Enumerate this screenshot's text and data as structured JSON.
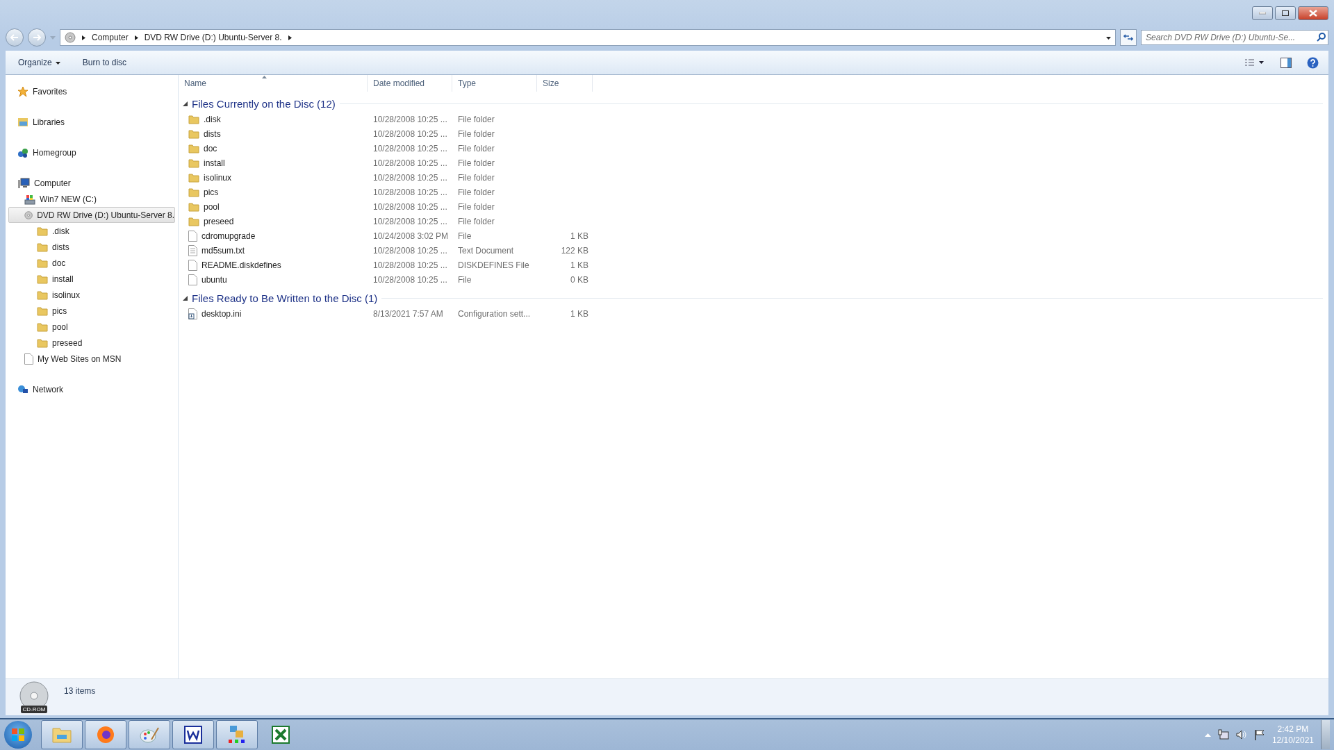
{
  "address": {
    "crumbs": [
      "Computer",
      "DVD RW Drive (D:) Ubuntu-Server 8."
    ]
  },
  "search": {
    "placeholder": "Search DVD RW Drive (D:) Ubuntu-Se..."
  },
  "toolbar": [
    {
      "label": "Organize",
      "dropdown": true
    },
    {
      "label": "Burn to disc",
      "dropdown": false
    }
  ],
  "sidebar": {
    "items": [
      {
        "label": "Favorites",
        "kind": "star",
        "selected": false
      },
      {
        "label": "Libraries",
        "kind": "library",
        "selected": false
      },
      {
        "label": "Homegroup",
        "kind": "homegroup",
        "selected": false
      },
      {
        "label": "Computer",
        "kind": "computer",
        "selected": false,
        "children": [
          {
            "label": "Win7 NEW (C:)",
            "kind": "drive",
            "selected": false
          },
          {
            "label": "DVD RW Drive (D:) Ubuntu-Server 8.",
            "kind": "dvd",
            "selected": true,
            "children": [
              {
                "label": ".disk",
                "kind": "folder",
                "selected": false
              },
              {
                "label": "dists",
                "kind": "folder",
                "selected": false
              },
              {
                "label": "doc",
                "kind": "folder",
                "selected": false
              },
              {
                "label": "install",
                "kind": "folder",
                "selected": false
              },
              {
                "label": "isolinux",
                "kind": "folder",
                "selected": false
              },
              {
                "label": "pics",
                "kind": "folder",
                "selected": false
              },
              {
                "label": "pool",
                "kind": "folder",
                "selected": false
              },
              {
                "label": "preseed",
                "kind": "folder",
                "selected": false
              }
            ]
          },
          {
            "label": "My Web Sites on MSN",
            "kind": "page",
            "selected": false
          }
        ]
      },
      {
        "label": "Network",
        "kind": "network",
        "selected": false
      }
    ]
  },
  "columns": [
    "Name",
    "Date modified",
    "Type",
    "Size"
  ],
  "groups": [
    {
      "title": "Files Currently on the Disc (12)",
      "expanded": true,
      "rows": [
        {
          "name": ".disk",
          "kind": "folder",
          "date": "10/28/2008 10:25 ...",
          "type": "File folder"
        },
        {
          "name": "dists",
          "kind": "folder",
          "date": "10/28/2008 10:25 ...",
          "type": "File folder"
        },
        {
          "name": "doc",
          "kind": "folder",
          "date": "10/28/2008 10:25 ...",
          "type": "File folder"
        },
        {
          "name": "install",
          "kind": "folder",
          "date": "10/28/2008 10:25 ...",
          "type": "File folder"
        },
        {
          "name": "isolinux",
          "kind": "folder",
          "date": "10/28/2008 10:25 ...",
          "type": "File folder"
        },
        {
          "name": "pics",
          "kind": "folder",
          "date": "10/28/2008 10:25 ...",
          "type": "File folder"
        },
        {
          "name": "pool",
          "kind": "folder",
          "date": "10/28/2008 10:25 ...",
          "type": "File folder"
        },
        {
          "name": "preseed",
          "kind": "folder",
          "date": "10/28/2008 10:25 ...",
          "type": "File folder"
        },
        {
          "name": "cdromupgrade",
          "kind": "file",
          "date": "10/24/2008 3:02 PM",
          "type": "File",
          "size": "1 KB"
        },
        {
          "name": "md5sum.txt",
          "kind": "text",
          "date": "10/28/2008 10:25 ...",
          "type": "Text Document",
          "size": "122 KB"
        },
        {
          "name": "README.diskdefines",
          "kind": "file",
          "date": "10/28/2008 10:25 ...",
          "type": "DISKDEFINES File",
          "size": "1 KB"
        },
        {
          "name": "ubuntu",
          "kind": "file",
          "date": "10/28/2008 10:25 ...",
          "type": "File",
          "size": "0 KB"
        }
      ]
    },
    {
      "title": "Files Ready to Be Written to the Disc (1)",
      "expanded": true,
      "rows": [
        {
          "name": "desktop.ini",
          "kind": "pending",
          "date": "8/13/2021 7:57 AM",
          "type": "Configuration sett...",
          "size": "1 KB"
        }
      ]
    }
  ],
  "status": {
    "count": "13 items",
    "badge": "CD-ROM"
  },
  "taskbar": {
    "apps": [
      {
        "kind": "explorer",
        "open": true
      },
      {
        "kind": "firefox",
        "open": true
      },
      {
        "kind": "paint",
        "open": true
      },
      {
        "kind": "word",
        "open": true
      },
      {
        "kind": "photos",
        "open": true
      },
      {
        "kind": "excel",
        "open": false
      }
    ],
    "clock": {
      "time": "2:42 PM",
      "date": "12/10/2021"
    }
  }
}
